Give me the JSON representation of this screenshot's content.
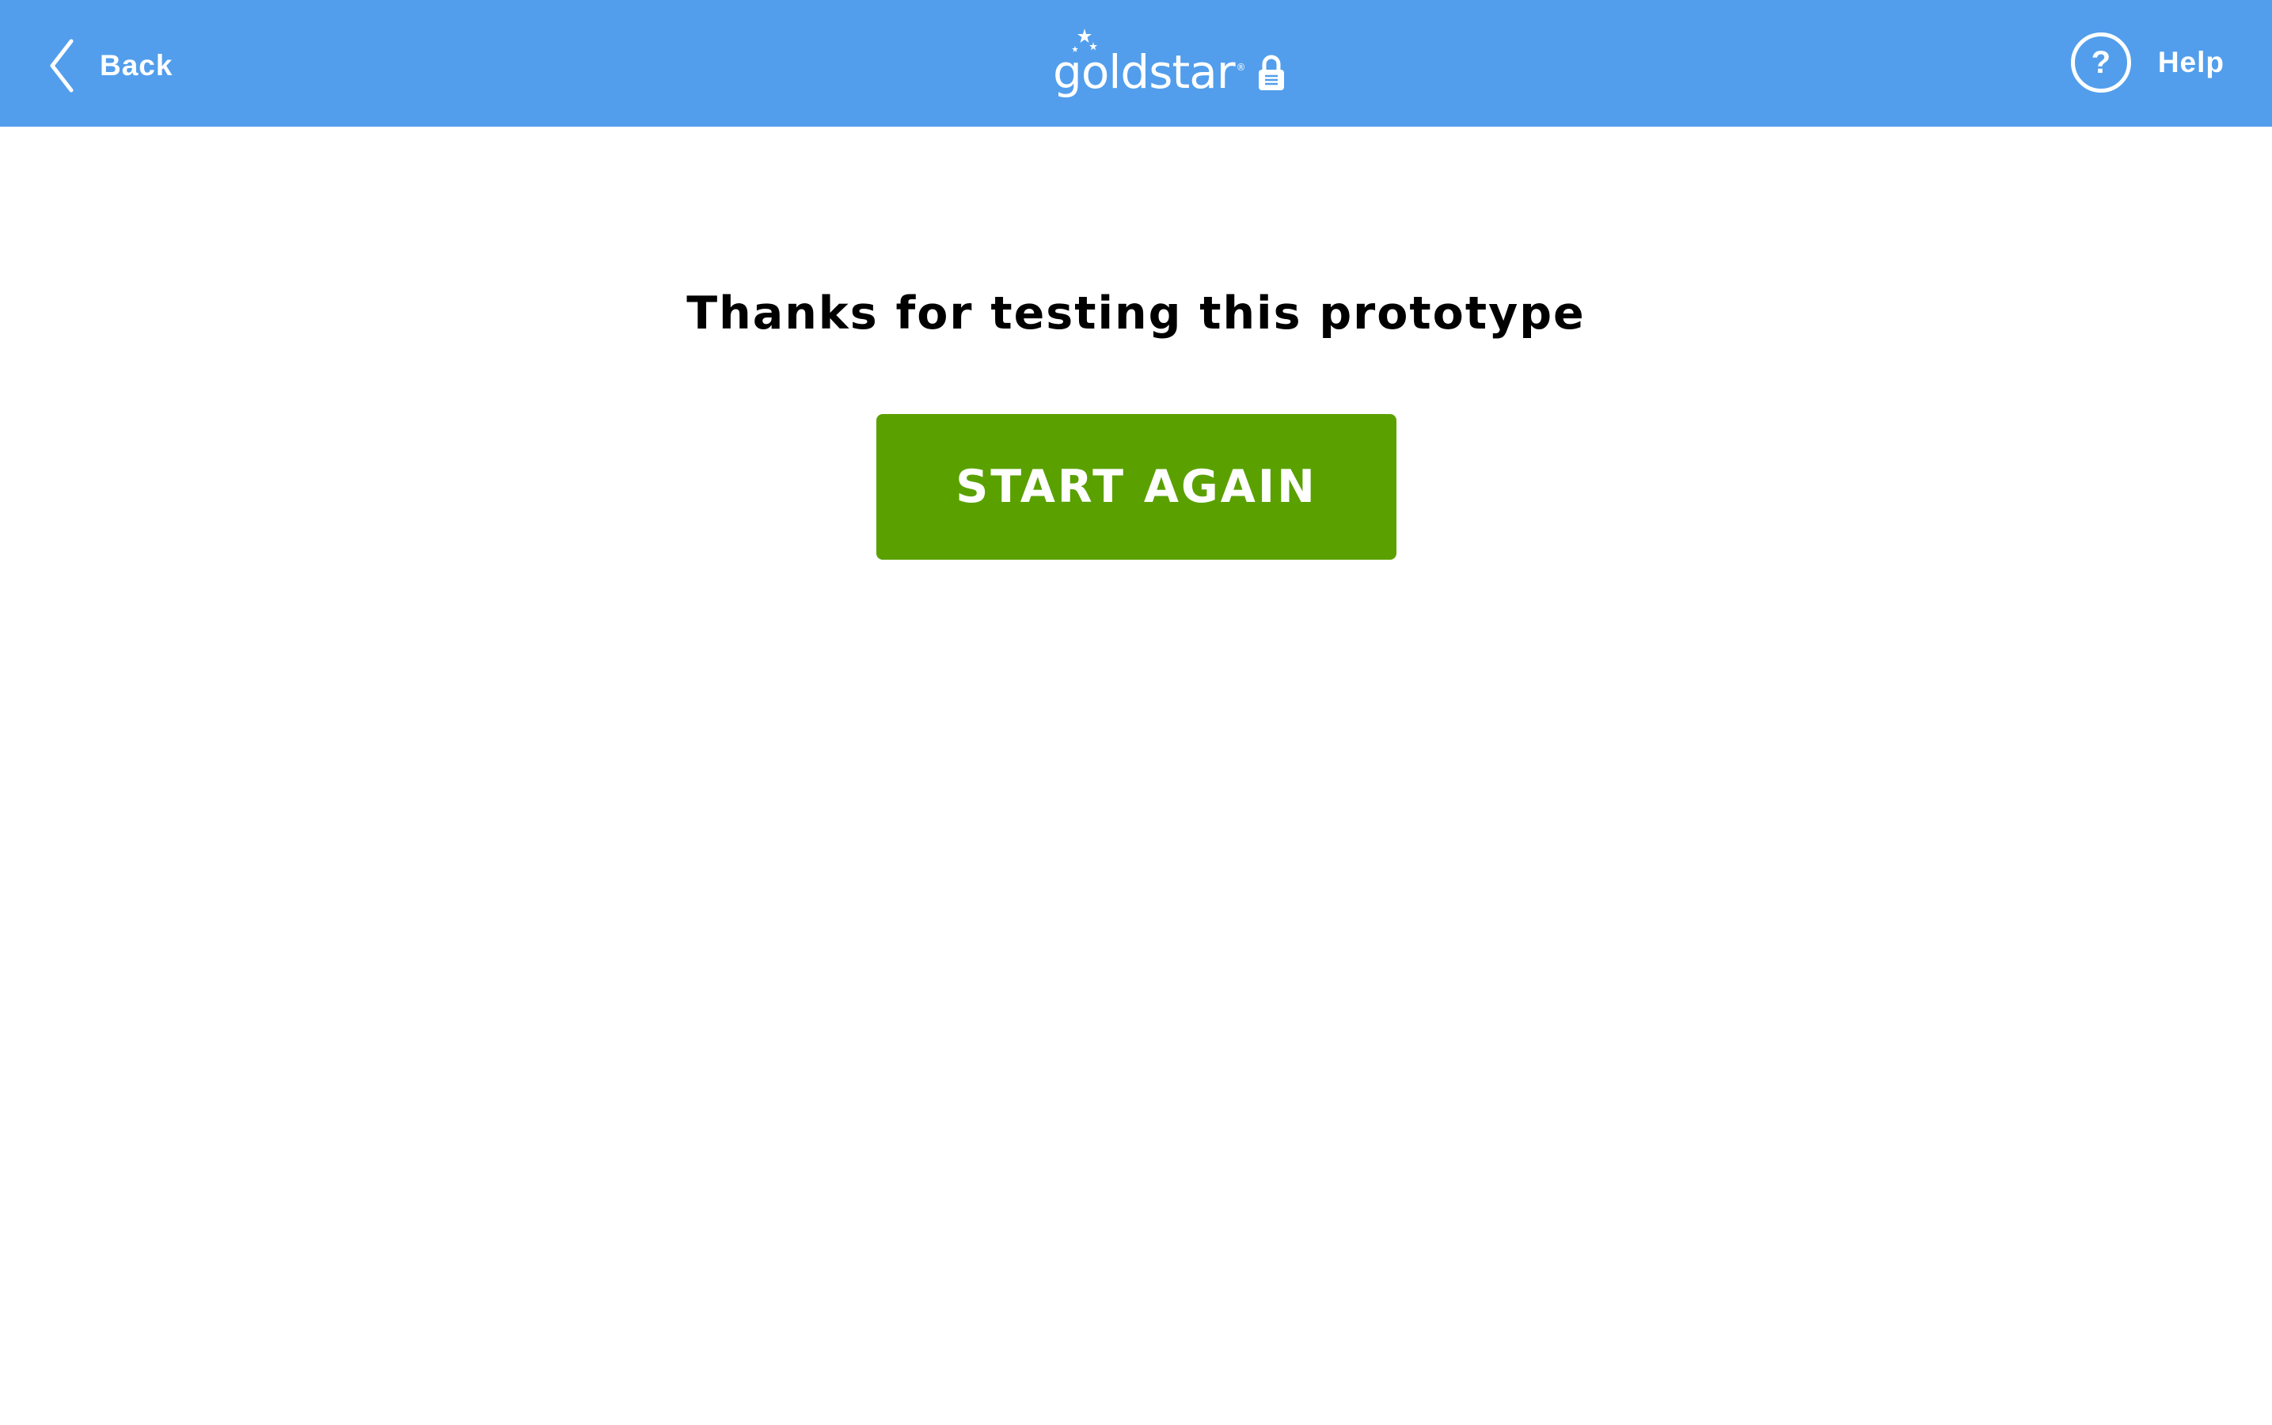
{
  "header": {
    "back_label": "Back",
    "brand": "goldstar",
    "brand_mark": "®",
    "help_symbol": "?",
    "help_label": "Help",
    "background_color": "#529EEC",
    "icons": {
      "back": "chevron-left-icon",
      "brand_stars": "stars-icon",
      "lock": "padlock-icon",
      "help": "question-circle-icon"
    }
  },
  "main": {
    "title": "Thanks for testing this prototype",
    "start_again_label": "START AGAIN",
    "button_color": "#5AA100"
  }
}
